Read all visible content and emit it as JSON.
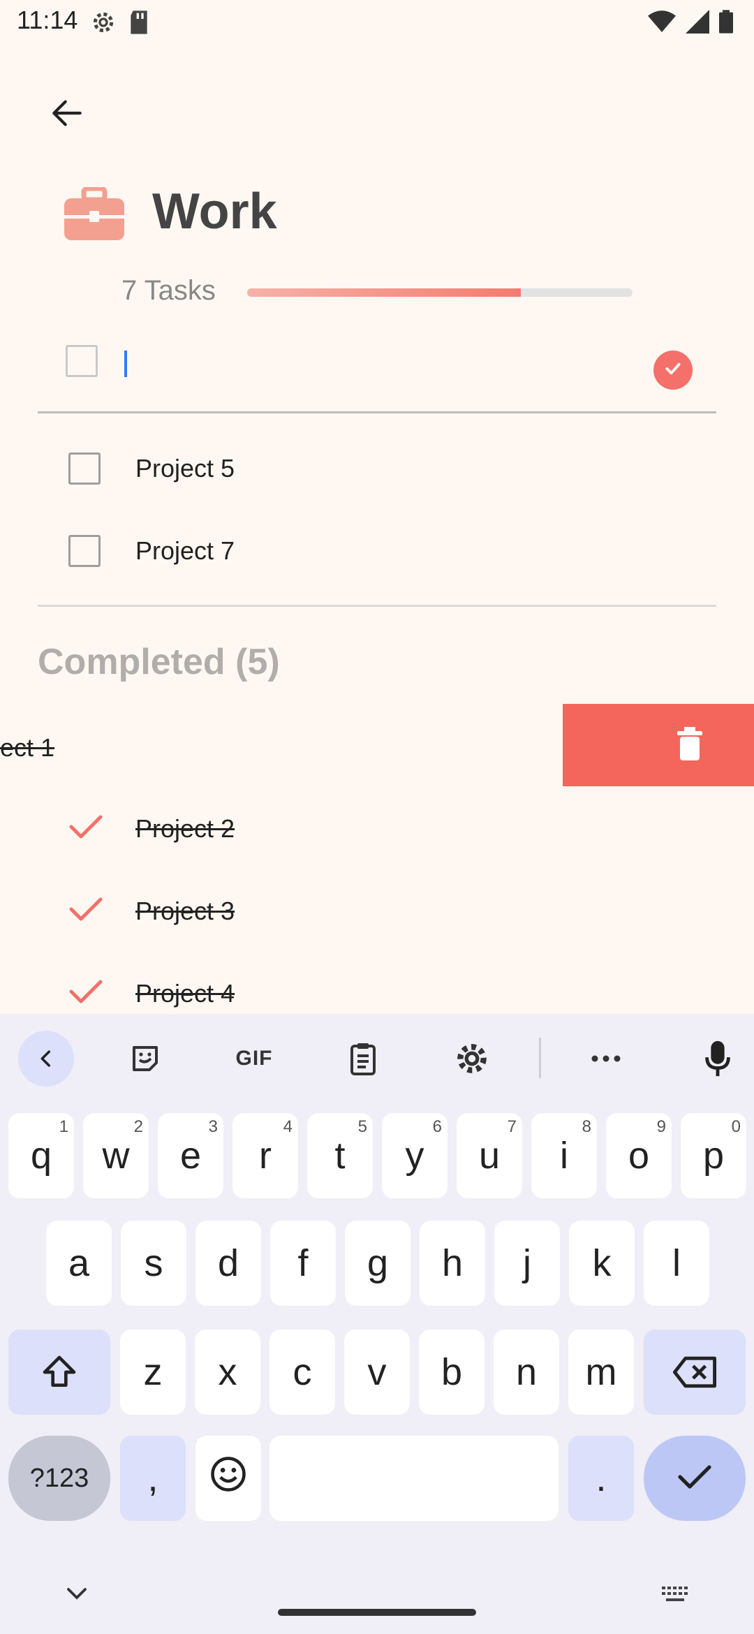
{
  "status_bar": {
    "time": "11:14",
    "icons_left": [
      "settings-gear-icon",
      "sd-card-icon"
    ],
    "icons_right": [
      "wifi-icon",
      "cell-signal-icon",
      "battery-icon"
    ]
  },
  "header": {
    "title": "Work",
    "icon": "briefcase-icon",
    "accent_color": "#F4706A",
    "task_count_label": "7 Tasks",
    "progress": 0.71
  },
  "new_task": {
    "value": "",
    "placeholder": ""
  },
  "tasks": [
    {
      "label": "Project 5",
      "done": false
    },
    {
      "label": "Project 7",
      "done": false
    }
  ],
  "completed": {
    "heading": "Completed (5)",
    "swiped_item_label": "ect 1",
    "items": [
      {
        "label": "Project 2"
      },
      {
        "label": "Project 3"
      },
      {
        "label": "Project 4"
      }
    ]
  },
  "keyboard": {
    "toolbar": [
      "collapse-icon",
      "sticker-icon",
      "GIF",
      "clipboard-icon",
      "settings-icon",
      "more-icon",
      "mic-icon"
    ],
    "gif_label": "GIF",
    "row1": [
      {
        "k": "q",
        "h": "1"
      },
      {
        "k": "w",
        "h": "2"
      },
      {
        "k": "e",
        "h": "3"
      },
      {
        "k": "r",
        "h": "4"
      },
      {
        "k": "t",
        "h": "5"
      },
      {
        "k": "y",
        "h": "6"
      },
      {
        "k": "u",
        "h": "7"
      },
      {
        "k": "i",
        "h": "8"
      },
      {
        "k": "o",
        "h": "9"
      },
      {
        "k": "p",
        "h": "0"
      }
    ],
    "row2": [
      "a",
      "s",
      "d",
      "f",
      "g",
      "h",
      "j",
      "k",
      "l"
    ],
    "row3": [
      "z",
      "x",
      "c",
      "v",
      "b",
      "n",
      "m"
    ],
    "sym_label": "?123",
    "comma": ",",
    "period": "."
  }
}
